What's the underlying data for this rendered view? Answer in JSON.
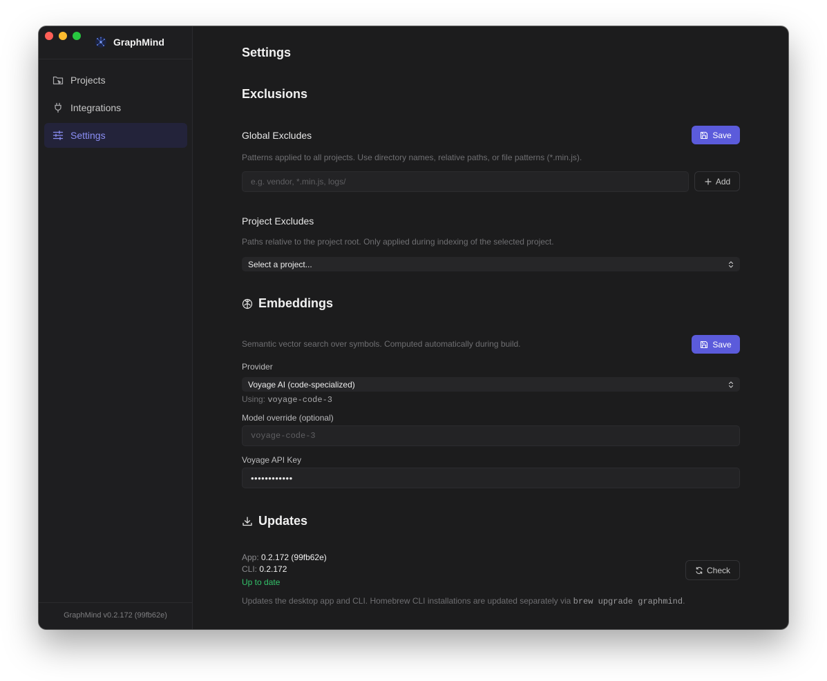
{
  "app": {
    "name": "GraphMind",
    "version_footer": "GraphMind v0.2.172 (99fb62e)"
  },
  "sidebar": {
    "items": [
      {
        "label": "Projects",
        "icon": "projects-icon"
      },
      {
        "label": "Integrations",
        "icon": "plug-icon"
      },
      {
        "label": "Settings",
        "icon": "sliders-icon",
        "active": true
      }
    ]
  },
  "main": {
    "page_title": "Settings",
    "exclusions": {
      "title": "Exclusions",
      "global": {
        "title": "Global Excludes",
        "save_label": "Save",
        "description": "Patterns applied to all projects. Use directory names, relative paths, or file patterns (*.min.js).",
        "input_placeholder": "e.g. vendor, *.min.js, logs/",
        "input_value": "",
        "add_label": "Add"
      },
      "project": {
        "title": "Project Excludes",
        "description": "Paths relative to the project root. Only applied during indexing of the selected project.",
        "select_value": "Select a project..."
      }
    },
    "embeddings": {
      "title": "Embeddings",
      "description": "Semantic vector search over symbols. Computed automatically during build.",
      "save_label": "Save",
      "provider_label": "Provider",
      "provider_value": "Voyage AI (code-specialized)",
      "using_prefix": "Using:",
      "using_model": "voyage-code-3",
      "model_override_label": "Model override (optional)",
      "model_override_placeholder": "voyage-code-3",
      "model_override_value": "",
      "api_key_label": "Voyage API Key",
      "api_key_value": "••••••••••••"
    },
    "updates": {
      "title": "Updates",
      "app_label": "App:",
      "app_version": "0.2.172 (99fb62e)",
      "cli_label": "CLI:",
      "cli_version": "0.2.172",
      "status": "Up to date",
      "check_label": "Check",
      "description_prefix": "Updates the desktop app and CLI. Homebrew CLI installations are updated separately via",
      "description_command": "brew upgrade graphmind",
      "description_suffix": "."
    }
  },
  "colors": {
    "accent": "#5b5bdb",
    "active_nav_text": "#8b8ff5",
    "success": "#33c26a",
    "window_bg": "#1c1c1d"
  }
}
